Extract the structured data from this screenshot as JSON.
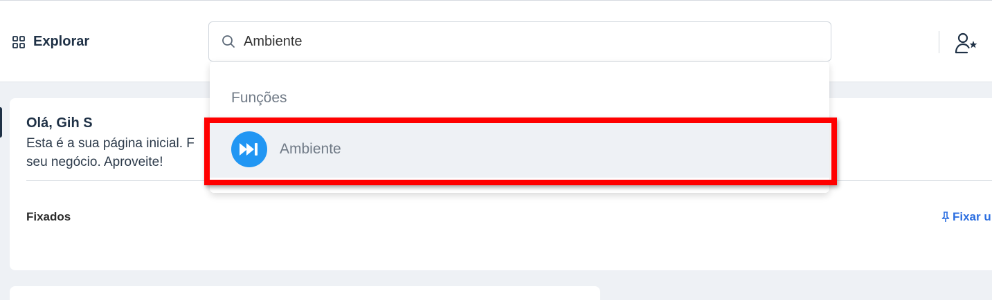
{
  "header": {
    "explore_label": "Explorar",
    "search_value": "Ambiente"
  },
  "home": {
    "greeting": "Olá, Gih S",
    "intro": "Esta é a sua página inicial. F seu negócio. Aproveite!",
    "pinned_title": "Fixados",
    "pin_link": "Fixar u"
  },
  "dropdown": {
    "section_label": "Funções",
    "results": [
      {
        "label": "Ambiente",
        "icon": "fast-forward-circle-icon"
      }
    ]
  },
  "colors": {
    "accent_blue": "#2196f3",
    "link_blue": "#2a6de0",
    "highlight_red": "#ff0000",
    "navy": "#1f3146"
  }
}
